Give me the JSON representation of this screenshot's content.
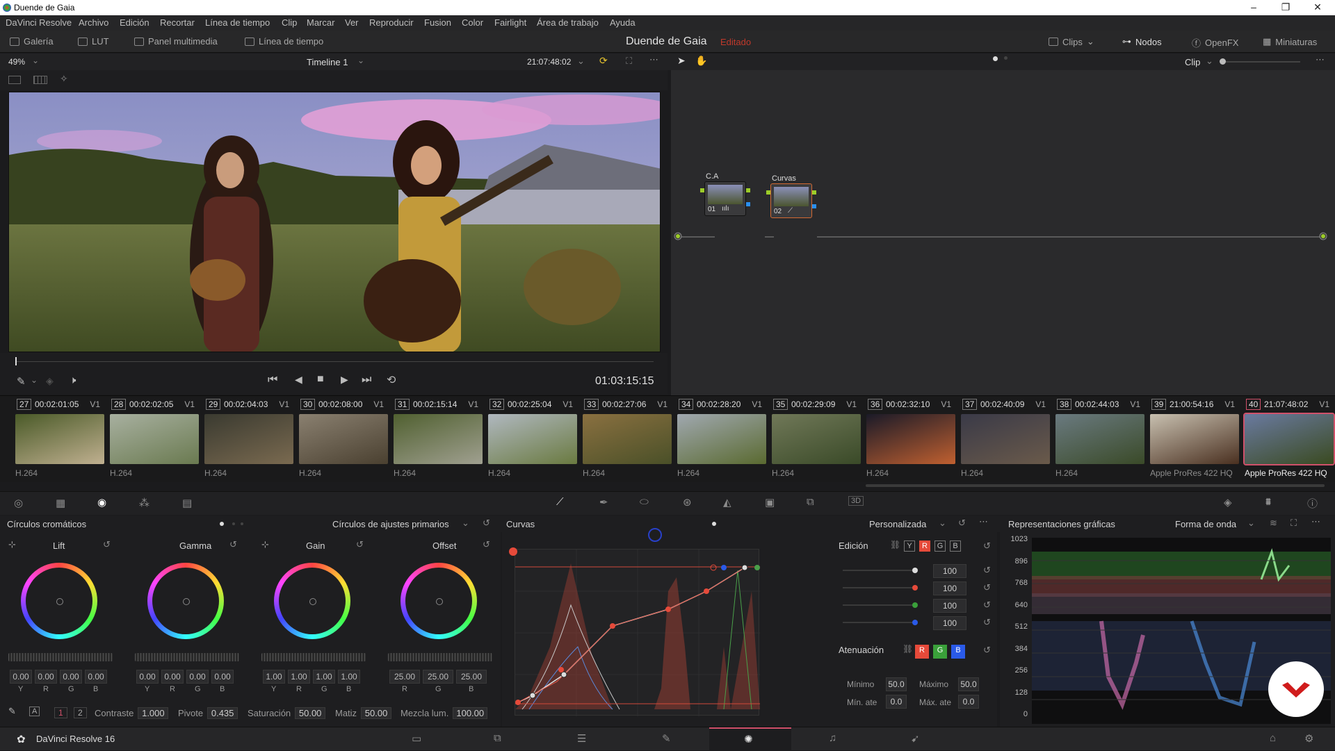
{
  "window": {
    "title": "Duende de Gaia",
    "min": "–",
    "max": "❐",
    "close": "✕"
  },
  "menu": [
    "DaVinci Resolve",
    "Archivo",
    "Edición",
    "Recortar",
    "Línea de tiempo",
    "Clip",
    "Marcar",
    "Ver",
    "Reproducir",
    "Fusion",
    "Color",
    "Fairlight",
    "Área de trabajo",
    "Ayuda"
  ],
  "toolbar": {
    "gallery": "Galería",
    "lut": "LUT",
    "media": "Panel multimedia",
    "timeline": "Línea de tiempo",
    "project_title": "Duende de Gaia",
    "project_status": "Editado",
    "clips": "Clips",
    "nodes": "Nodos",
    "openfx": "OpenFX",
    "thumbnails": "Miniaturas"
  },
  "viewer": {
    "zoom": "49%",
    "timeline_name": "Timeline 1",
    "timecode_top": "21:07:48:02",
    "playhead_timecode": "01:03:15:15",
    "node_mode": "Clip"
  },
  "nodes": [
    {
      "label": "C.A",
      "num": "01"
    },
    {
      "label": "Curvas",
      "num": "02"
    }
  ],
  "clips": [
    {
      "n": "27",
      "tc": "00:02:01:05",
      "track": "V1",
      "codec": "H.264"
    },
    {
      "n": "28",
      "tc": "00:02:02:05",
      "track": "V1",
      "codec": "H.264"
    },
    {
      "n": "29",
      "tc": "00:02:04:03",
      "track": "V1",
      "codec": "H.264"
    },
    {
      "n": "30",
      "tc": "00:02:08:00",
      "track": "V1",
      "codec": "H.264"
    },
    {
      "n": "31",
      "tc": "00:02:15:14",
      "track": "V1",
      "codec": "H.264"
    },
    {
      "n": "32",
      "tc": "00:02:25:04",
      "track": "V1",
      "codec": "H.264"
    },
    {
      "n": "33",
      "tc": "00:02:27:06",
      "track": "V1",
      "codec": "H.264"
    },
    {
      "n": "34",
      "tc": "00:02:28:20",
      "track": "V1",
      "codec": "H.264"
    },
    {
      "n": "35",
      "tc": "00:02:29:09",
      "track": "V1",
      "codec": "H.264"
    },
    {
      "n": "36",
      "tc": "00:02:32:10",
      "track": "V1",
      "codec": "H.264"
    },
    {
      "n": "37",
      "tc": "00:02:40:09",
      "track": "V1",
      "codec": "H.264"
    },
    {
      "n": "38",
      "tc": "00:02:44:03",
      "track": "V1",
      "codec": "H.264"
    },
    {
      "n": "39",
      "tc": "21:00:54:16",
      "track": "V1",
      "codec": "Apple ProRes 422 HQ"
    },
    {
      "n": "40",
      "tc": "21:07:48:02",
      "track": "V1",
      "codec": "Apple ProRes 422 HQ"
    }
  ],
  "wheels_panel": {
    "title": "Círculos cromáticos",
    "mode": "Círculos de ajustes primarios",
    "wheels": [
      {
        "name": "Lift",
        "values": [
          "0.00",
          "0.00",
          "0.00",
          "0.00"
        ],
        "labels": [
          "Y",
          "R",
          "G",
          "B"
        ]
      },
      {
        "name": "Gamma",
        "values": [
          "0.00",
          "0.00",
          "0.00",
          "0.00"
        ],
        "labels": [
          "Y",
          "R",
          "G",
          "B"
        ]
      },
      {
        "name": "Gain",
        "values": [
          "1.00",
          "1.00",
          "1.00",
          "1.00"
        ],
        "labels": [
          "Y",
          "R",
          "G",
          "B"
        ]
      },
      {
        "name": "Offset",
        "values": [
          "25.00",
          "25.00",
          "25.00"
        ],
        "labels": [
          "R",
          "G",
          "B"
        ]
      }
    ],
    "page1": "1",
    "page2": "2",
    "contrast_label": "Contraste",
    "contrast": "1.000",
    "pivot_label": "Pivote",
    "pivot": "0.435",
    "sat_label": "Saturación",
    "sat": "50.00",
    "hue_label": "Matiz",
    "hue": "50.00",
    "lummix_label": "Mezcla lum.",
    "lummix": "100.00"
  },
  "curves_panel": {
    "title": "Curvas",
    "mode": "Personalizada",
    "edit_label": "Edición",
    "channels": [
      "Y",
      "R",
      "G",
      "B"
    ],
    "intensity": [
      "100",
      "100",
      "100",
      "100"
    ],
    "softclip_label": "Atenuación",
    "min_label": "Mínimo",
    "min": "50.0",
    "max_label": "Máximo",
    "max": "50.0",
    "minat_label": "Mín. ate",
    "minat": "0.0",
    "maxat_label": "Máx. ate",
    "maxat": "0.0"
  },
  "scopes_panel": {
    "title": "Representaciones gráficas",
    "mode": "Forma de onda",
    "ticks": [
      "1023",
      "896",
      "768",
      "640",
      "512",
      "384",
      "256",
      "128",
      "0"
    ]
  },
  "status": {
    "app": "DaVinci Resolve 16"
  }
}
